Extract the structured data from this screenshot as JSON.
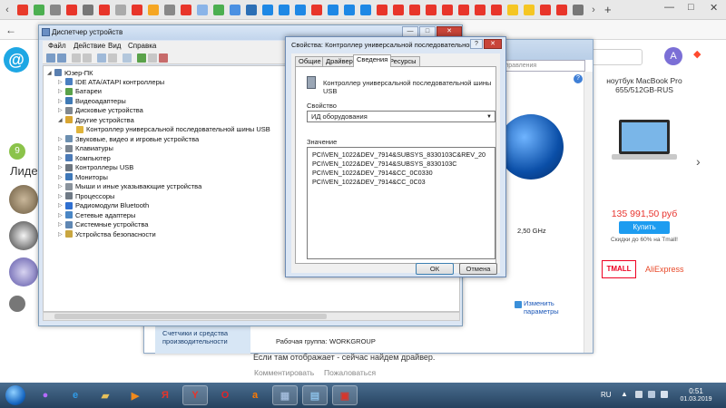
{
  "browser": {
    "window_controls": [
      "—",
      "□",
      "✕"
    ]
  },
  "site": {
    "logo_char": "@",
    "avatar_letter": "A",
    "badge_number": "9",
    "leaders_heading": "Лидер",
    "bottom_text": "Если там отображает - сейчас найдем драйвер.",
    "comment_label": "Комментировать",
    "complain_label": "Пожаловаться"
  },
  "ad": {
    "title": "ноутбук MacBook Pro 655/512GB-RUS",
    "price": "135 991,50 руб",
    "buy_label": "Купить",
    "note": "Скидки до 60% на Tmall!",
    "tmall_label": "TMALL",
    "aliexpress_label": "AliExpress"
  },
  "system_window": {
    "search_placeholder": "управления",
    "help_glyph": "?",
    "ghz_label": "G",
    "ghz_value": "2,50 GHz",
    "change_params": "Изменить параметры",
    "counters_text": "Счетчики и средства производительности",
    "workgroup_label": "Рабочая группа:",
    "workgroup_value": "WORKGROUP"
  },
  "device_manager": {
    "title": "Диспетчер устройств",
    "menu": [
      "Файл",
      "Действие",
      "Вид",
      "Справка"
    ],
    "root": "Юзер-ПК",
    "tree": [
      {
        "label": "IDE ATA/ATAPI контроллеры",
        "indent": 1,
        "state": "collapsed",
        "icon": "#4a7fc1"
      },
      {
        "label": "Батареи",
        "indent": 1,
        "state": "collapsed",
        "icon": "#5aa24a"
      },
      {
        "label": "Видеоадаптеры",
        "indent": 1,
        "state": "collapsed",
        "icon": "#3f7ab5"
      },
      {
        "label": "Дисковые устройства",
        "indent": 1,
        "state": "collapsed",
        "icon": "#808890"
      },
      {
        "label": "Другие устройства",
        "indent": 1,
        "state": "expanded",
        "icon": "#d8a532"
      },
      {
        "label": "Контроллер универсальной последовательной шины USB",
        "indent": 2,
        "state": "none",
        "icon": "#e0b43a"
      },
      {
        "label": "Звуковые, видео и игровые устройства",
        "indent": 1,
        "state": "collapsed",
        "icon": "#6c8fb0"
      },
      {
        "label": "Клавиатуры",
        "indent": 1,
        "state": "collapsed",
        "icon": "#7b8591"
      },
      {
        "label": "Компьютер",
        "indent": 1,
        "state": "collapsed",
        "icon": "#4b7ab6"
      },
      {
        "label": "Контроллеры USB",
        "indent": 1,
        "state": "collapsed",
        "icon": "#6d7680"
      },
      {
        "label": "Мониторы",
        "indent": 1,
        "state": "collapsed",
        "icon": "#3f78b8"
      },
      {
        "label": "Мыши и иные указывающие устройства",
        "indent": 1,
        "state": "collapsed",
        "icon": "#8a939d"
      },
      {
        "label": "Процессоры",
        "indent": 1,
        "state": "collapsed",
        "icon": "#6f7a86"
      },
      {
        "label": "Радиомодули Bluetooth",
        "indent": 1,
        "state": "collapsed",
        "icon": "#2f6fd0"
      },
      {
        "label": "Сетевые адаптеры",
        "indent": 1,
        "state": "collapsed",
        "icon": "#4a86c5"
      },
      {
        "label": "Системные устройства",
        "indent": 1,
        "state": "collapsed",
        "icon": "#5f87b3"
      },
      {
        "label": "Устройства безопасности",
        "indent": 1,
        "state": "collapsed",
        "icon": "#c9a640"
      }
    ]
  },
  "properties": {
    "title": "Свойства: Контроллер универсальной последовательной шин...",
    "tabs": [
      "Общие",
      "Драйвер",
      "Сведения",
      "Ресурсы"
    ],
    "active_tab": "Сведения",
    "device_name": "Контроллер универсальной последовательной шины USB",
    "property_label": "Свойство",
    "property_selected": "ИД оборудования",
    "value_label": "Значение",
    "values": [
      "PCI\\VEN_1022&DEV_7914&SUBSYS_8330103C&REV_20",
      "PCI\\VEN_1022&DEV_7914&SUBSYS_8330103C",
      "PCI\\VEN_1022&DEV_7914&CC_0C0330",
      "PCI\\VEN_1022&DEV_7914&CC_0C03"
    ],
    "ok_label": "ОК",
    "cancel_label": "Отмена"
  },
  "taskbar": {
    "apps": [
      {
        "name": "browser-yandex-alice",
        "glyph": "●",
        "color": "#b46bff",
        "running": false
      },
      {
        "name": "internet-explorer",
        "glyph": "e",
        "color": "#2f9be8",
        "running": false
      },
      {
        "name": "file-explorer",
        "glyph": "▰",
        "color": "#e8c15a",
        "running": false
      },
      {
        "name": "media-player",
        "glyph": "▶",
        "color": "#f08a1d",
        "running": false
      },
      {
        "name": "yandex-browser",
        "glyph": "Я",
        "color": "#e8342a",
        "running": false
      },
      {
        "name": "yandex-app",
        "glyph": "Y",
        "color": "#e8342a",
        "running": true
      },
      {
        "name": "opera",
        "glyph": "O",
        "color": "#e0242a",
        "running": false
      },
      {
        "name": "avast",
        "glyph": "a",
        "color": "#ff7a00",
        "running": false
      },
      {
        "name": "app-square",
        "glyph": "▦",
        "color": "#9fb8d8",
        "running": true
      },
      {
        "name": "control-panel",
        "glyph": "▤",
        "color": "#8cc0e8",
        "running": true
      },
      {
        "name": "toolbox",
        "glyph": "▣",
        "color": "#d8352a",
        "running": true
      }
    ],
    "lang": "RU",
    "tray_up": "▲",
    "time": "0:51",
    "date": "01.03.2019"
  }
}
